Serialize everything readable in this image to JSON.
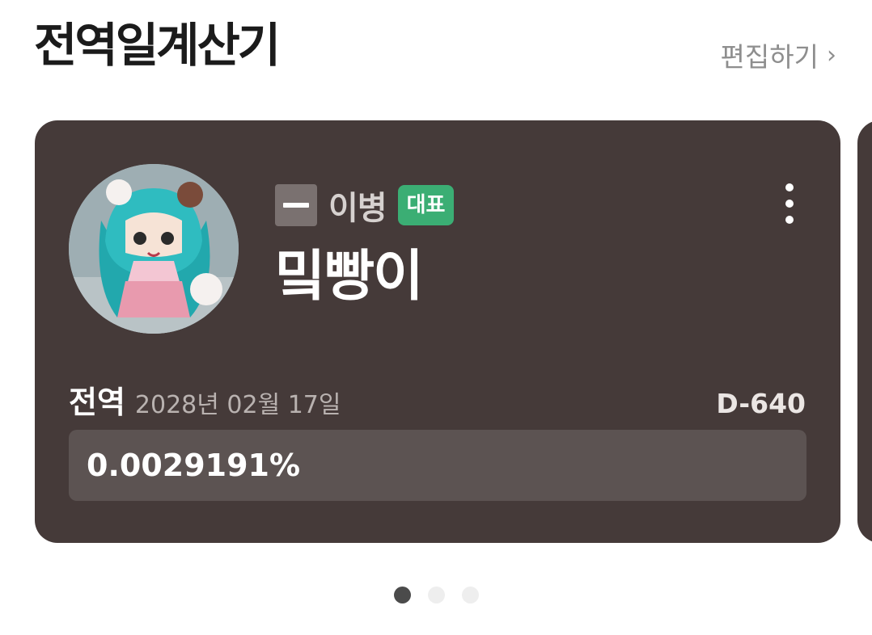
{
  "header": {
    "title": "전역일계산기",
    "edit_label": "편집하기",
    "edit_chevron": "›"
  },
  "card": {
    "rank_icon": "private-rank-icon",
    "rank": "이병",
    "badge": "대표",
    "name": "밐빵이",
    "avatar_icon": "plush-doll-avatar",
    "discharge_label": "전역",
    "discharge_date": "2028년 02월 17일",
    "dday": "D-640",
    "progress_text": "0.0029191%",
    "progress_fraction": 2.9191e-05
  },
  "pagination": {
    "count": 3,
    "active_index": 0
  },
  "colors": {
    "card_bg": "#453a39",
    "badge_green": "#3bae74",
    "progress_track": "#5c5352"
  }
}
